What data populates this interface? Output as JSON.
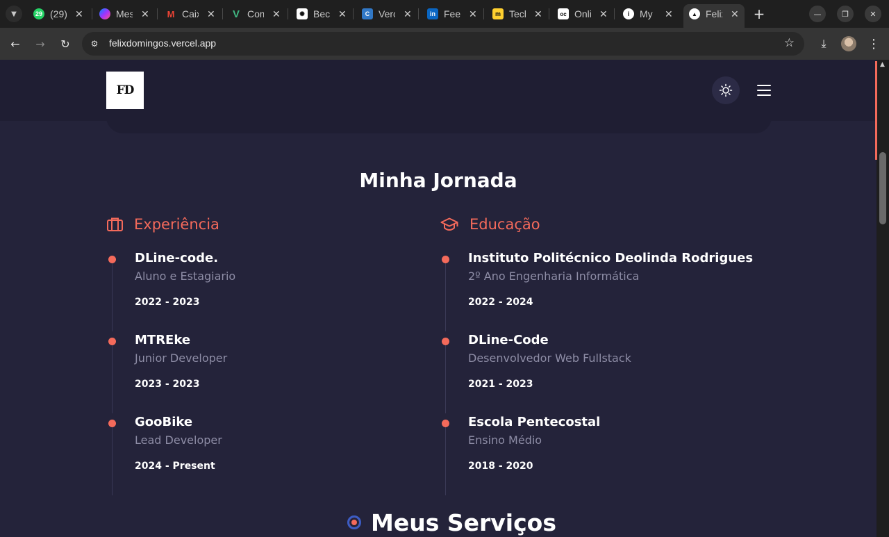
{
  "browser": {
    "tabs": [
      {
        "title": "(29)",
        "icon": "whatsapp-icon",
        "color": "#25d366"
      },
      {
        "title": "Messenger",
        "icon": "messenger-icon",
        "color": "#a033ff"
      },
      {
        "title": "Caixa",
        "icon": "gmail-icon",
        "color": "#ea4335"
      },
      {
        "title": "Componentes",
        "icon": "vue-icon",
        "color": "#41b883"
      },
      {
        "title": "Become",
        "icon": "openai-icon",
        "color": "#ffffff"
      },
      {
        "title": "Vercel",
        "icon": "ts-icon",
        "color": "#3178c6"
      },
      {
        "title": "Feed",
        "icon": "linkedin-icon",
        "color": "#0a66c2"
      },
      {
        "title": "Tech",
        "icon": "miro-icon",
        "color": "#ffd02f"
      },
      {
        "title": "Online",
        "icon": "oc-icon",
        "color": "#ffffff"
      },
      {
        "title": "My",
        "icon": "info-icon",
        "color": "#ffffff"
      },
      {
        "title": "Felix",
        "icon": "vercel-icon",
        "color": "#ffffff",
        "active": true
      }
    ],
    "new_tab": "+",
    "url": "felixdomingos.vercel.app"
  },
  "header": {
    "logo_text": "FD"
  },
  "journey": {
    "title": "Minha Jornada",
    "experience_label": "Experiência",
    "education_label": "Educação",
    "experience": [
      {
        "title": "DLine-code.",
        "subtitle": "Aluno e Estagiario",
        "date": "2022 - 2023"
      },
      {
        "title": "MTREke",
        "subtitle": "Junior Developer",
        "date": "2023 - 2023"
      },
      {
        "title": "GooBike",
        "subtitle": "Lead Developer",
        "date": "2024 - Present"
      }
    ],
    "education": [
      {
        "title": "Instituto Politécnico Deolinda Rodrigues",
        "subtitle": "2º Ano Engenharia Informática",
        "date": "2022 - 2024"
      },
      {
        "title": "DLine-Code",
        "subtitle": "Desenvolvedor Web Fullstack",
        "date": "2021 - 2023"
      },
      {
        "title": "Escola Pentecostal",
        "subtitle": "Ensino Médio",
        "date": "2018 - 2020"
      }
    ]
  },
  "services": {
    "title": "Meus Serviços"
  },
  "colors": {
    "accent": "#f46a5b",
    "background": "#24233a",
    "header": "#1f1e33"
  }
}
